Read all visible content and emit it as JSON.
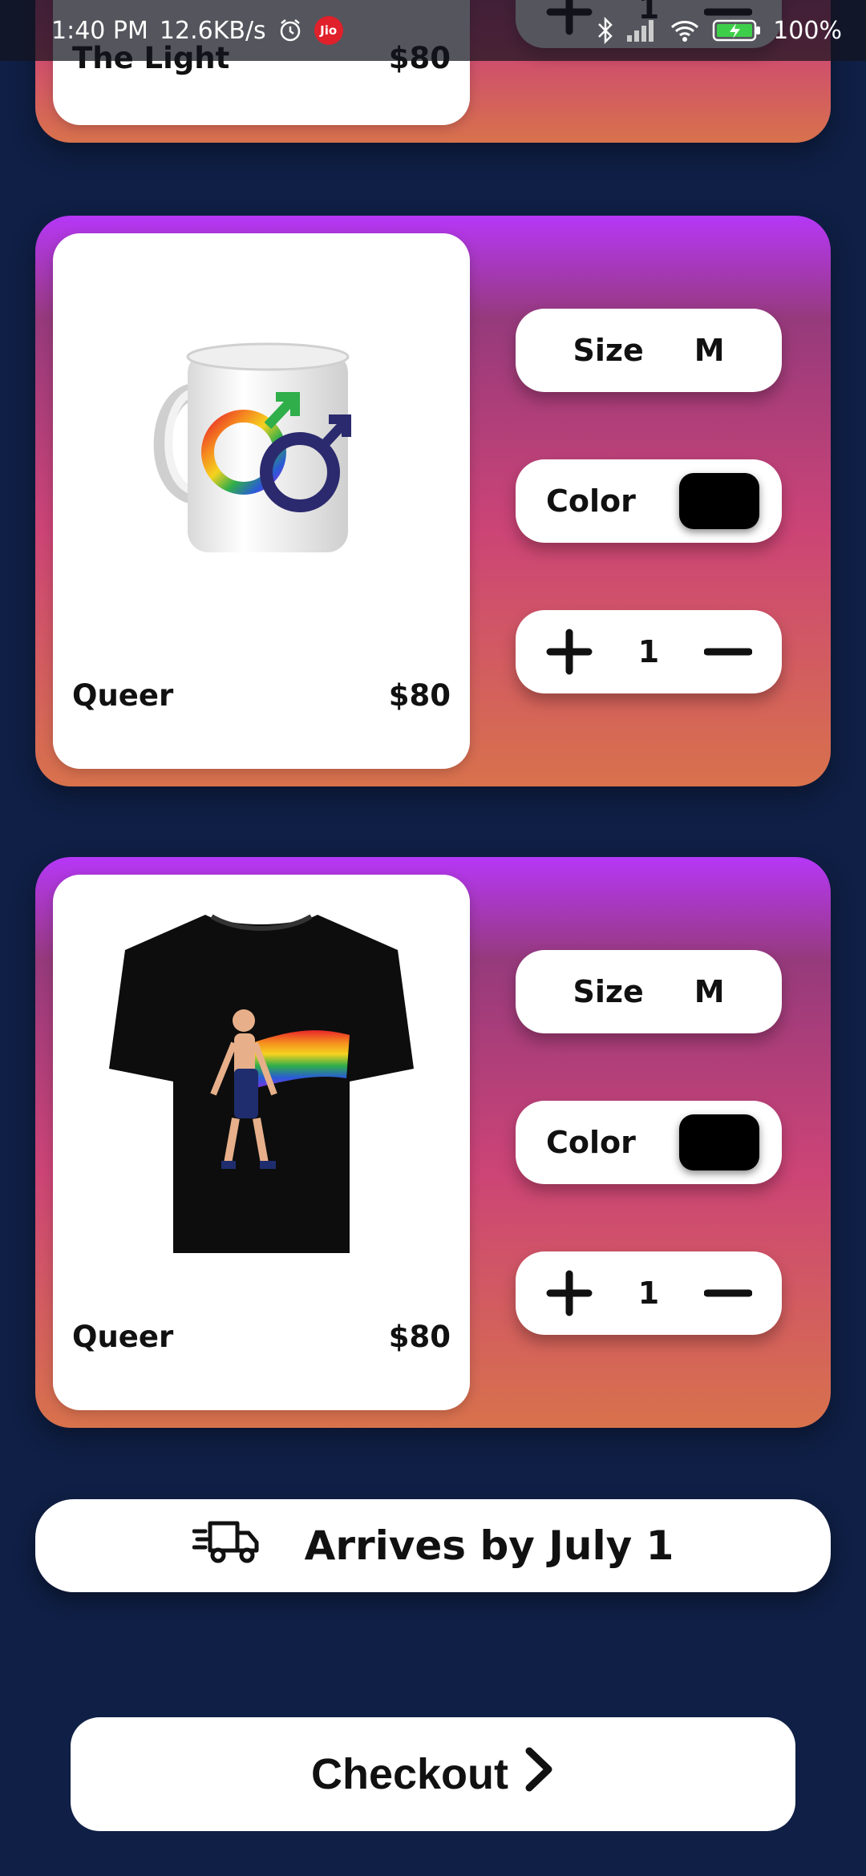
{
  "status_bar": {
    "time": "1:40 PM",
    "speed": "12.6KB/s",
    "carrier": "Jio",
    "battery": "100%"
  },
  "cart": [
    {
      "name": "The Light",
      "price": "$80",
      "quantity": "1"
    },
    {
      "name": "Queer",
      "price": "$80",
      "size_label": "Size",
      "size": "M",
      "color_label": "Color",
      "color_value": "#000000",
      "quantity": "1",
      "image": "rainbow-male-symbols-mug"
    },
    {
      "name": "Queer",
      "price": "$80",
      "size_label": "Size",
      "size": "M",
      "color_label": "Color",
      "color_value": "#000000",
      "quantity": "1",
      "image": "pride-cape-black-tshirt"
    }
  ],
  "delivery": {
    "text": "Arrives by July 1",
    "icon": "delivery-truck-icon"
  },
  "checkout": {
    "label": "Checkout",
    "icon": "chevron-right-icon"
  },
  "colors": {
    "background": "#0f1f45",
    "card_gradient_top": "#b637f7",
    "card_gradient_mid": "#cc4476",
    "card_gradient_bottom": "#d8724c"
  }
}
